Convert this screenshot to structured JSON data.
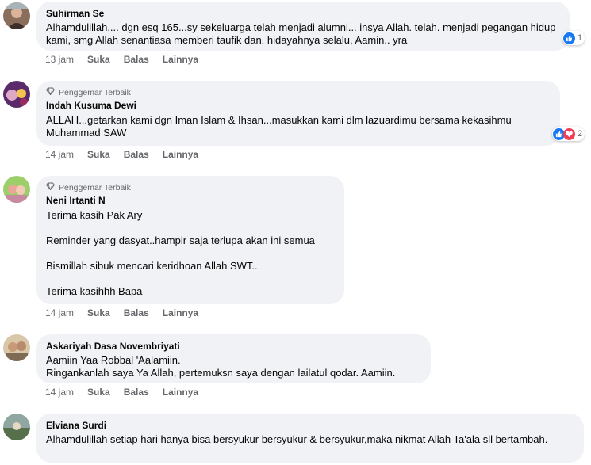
{
  "comments": [
    {
      "author": "Suhirman Se",
      "badge": "",
      "text": "Alhamdulillah.... dgn esq 165...sy sekeluarga telah menjadi alumni... insya Allah. telah. menjadi pegangan hidup kami, smg Allah senantiasa memberi taufik dan. hidayahnya selalu, Aamin.. yra",
      "time": "13 jam",
      "like": "Suka",
      "reply": "Balas",
      "more": "Lainnya",
      "reaction_count": "1"
    },
    {
      "author": "Indah Kusuma Dewi",
      "badge": "Penggemar Terbaik",
      "text": "ALLAH...getarkan kami dgn Iman Islam & Ihsan...masukkan kami dlm lazuardimu bersama kekasihmu Muhammad SAW",
      "time": "14 jam",
      "like": "Suka",
      "reply": "Balas",
      "more": "Lainnya",
      "reaction_count": "2"
    },
    {
      "author": "Neni Irtanti N",
      "badge": "Penggemar Terbaik",
      "paragraphs": [
        "Terima kasih Pak Ary",
        "Reminder yang dasyat..hampir saja terlupa akan ini semua",
        "Bismillah sibuk mencari keridhoan Allah SWT..",
        "Terima kasihhh Bapa"
      ],
      "time": "14 jam",
      "like": "Suka",
      "reply": "Balas",
      "more": "Lainnya"
    },
    {
      "author": "Askariyah Dasa Novembriyati",
      "badge": "",
      "line1": "Aamiin Yaa Robbal 'Aalamiin.",
      "line2": "Ringankanlah saya Ya Allah, pertemuksn saya dengan lailatul qodar. Aamiin.",
      "time": "14 jam",
      "like": "Suka",
      "reply": "Balas",
      "more": "Lainnya"
    },
    {
      "author": "Elviana Surdi",
      "badge": "",
      "text": "Alhamdulillah setiap hari hanya bisa bersyukur bersyukur & bersyukur,maka nikmat Allah Ta'ala sll bertambah."
    }
  ],
  "icons": {
    "badge": "diamond-icon",
    "like_reaction": "thumbs-up-icon",
    "love_reaction": "heart-icon"
  },
  "colors": {
    "bubble": "#f0f2f5",
    "like_blue": "#1877f2",
    "love_red": "#f33e58",
    "meta_gray": "#65676b"
  }
}
